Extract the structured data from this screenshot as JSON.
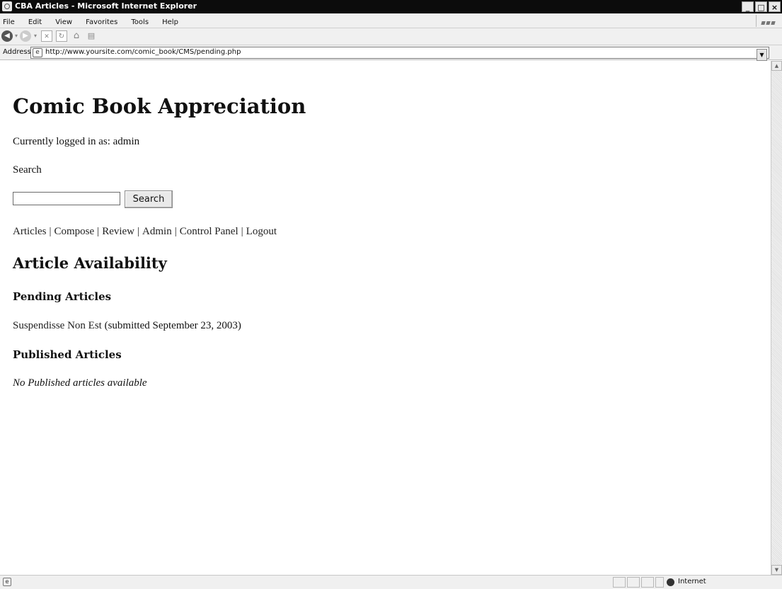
{
  "window": {
    "title": "CBA Articles - Microsoft Internet Explorer",
    "controls": {
      "minimize": "_",
      "maximize": "□",
      "close": "×"
    }
  },
  "menubar": {
    "items": [
      "File",
      "Edit",
      "View",
      "Favorites",
      "Tools",
      "Help"
    ]
  },
  "toolbar": {
    "icons": [
      "back-icon",
      "forward-icon",
      "stop-icon",
      "refresh-icon",
      "home-icon",
      "print-icon"
    ]
  },
  "addressbar": {
    "label": "Address",
    "url": "http://www.yoursite.com/comic_book/CMS/pending.php"
  },
  "page": {
    "site_title": "Comic Book Appreciation",
    "logged_in_text": "Currently logged in as: admin",
    "search_label": "Search",
    "search_input_value": "",
    "search_button": "Search",
    "nav": [
      "Articles",
      "Compose",
      "Review",
      "Admin",
      "Control Panel",
      "Logout"
    ],
    "section_title": "Article Availability",
    "pending_heading": "Pending Articles",
    "pending_articles": [
      {
        "title": "Suspendisse Non Est",
        "meta": "(submitted September 23, 2003)"
      }
    ],
    "published_heading": "Published Articles",
    "no_published_text": "No Published articles available"
  },
  "statusbar": {
    "zone": "Internet"
  }
}
